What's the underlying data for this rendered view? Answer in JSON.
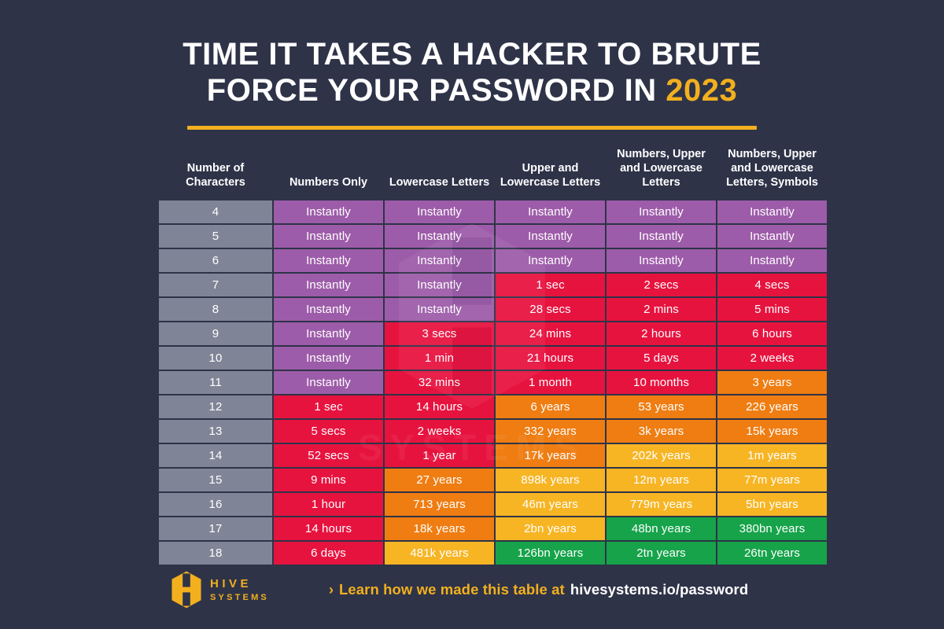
{
  "title": {
    "line1": "TIME IT TAKES A HACKER TO BRUTE",
    "line2_prefix": "FORCE YOUR PASSWORD IN ",
    "year": "2023"
  },
  "colors": {
    "background": "#2e3348",
    "accent_gold": "#f2b01e",
    "instant_purple": "#9d5ca9",
    "red": "#e7133f",
    "orange": "#ef7d12",
    "amber": "#f7b524",
    "green": "#16a34a",
    "gray": "#7f8596",
    "text_white": "#ffffff"
  },
  "watermark": {
    "text": "SYSTEMS"
  },
  "table": {
    "headers": [
      "Number of Characters",
      "Numbers Only",
      "Lowercase Letters",
      "Upper and Lowercase Letters",
      "Numbers, Upper and Lowercase Letters",
      "Numbers, Upper and Lowercase Letters, Symbols"
    ],
    "rows": [
      {
        "chars": "4",
        "cells": [
          {
            "text": "Instantly",
            "color": "purple"
          },
          {
            "text": "Instantly",
            "color": "purple"
          },
          {
            "text": "Instantly",
            "color": "purple"
          },
          {
            "text": "Instantly",
            "color": "purple"
          },
          {
            "text": "Instantly",
            "color": "purple"
          }
        ]
      },
      {
        "chars": "5",
        "cells": [
          {
            "text": "Instantly",
            "color": "purple"
          },
          {
            "text": "Instantly",
            "color": "purple"
          },
          {
            "text": "Instantly",
            "color": "purple"
          },
          {
            "text": "Instantly",
            "color": "purple"
          },
          {
            "text": "Instantly",
            "color": "purple"
          }
        ]
      },
      {
        "chars": "6",
        "cells": [
          {
            "text": "Instantly",
            "color": "purple"
          },
          {
            "text": "Instantly",
            "color": "purple"
          },
          {
            "text": "Instantly",
            "color": "purple"
          },
          {
            "text": "Instantly",
            "color": "purple"
          },
          {
            "text": "Instantly",
            "color": "purple"
          }
        ]
      },
      {
        "chars": "7",
        "cells": [
          {
            "text": "Instantly",
            "color": "purple"
          },
          {
            "text": "Instantly",
            "color": "purple"
          },
          {
            "text": "1 sec",
            "color": "red"
          },
          {
            "text": "2 secs",
            "color": "red"
          },
          {
            "text": "4 secs",
            "color": "red"
          }
        ]
      },
      {
        "chars": "8",
        "cells": [
          {
            "text": "Instantly",
            "color": "purple"
          },
          {
            "text": "Instantly",
            "color": "purple"
          },
          {
            "text": "28 secs",
            "color": "red"
          },
          {
            "text": "2 mins",
            "color": "red"
          },
          {
            "text": "5 mins",
            "color": "red"
          }
        ]
      },
      {
        "chars": "9",
        "cells": [
          {
            "text": "Instantly",
            "color": "purple"
          },
          {
            "text": "3 secs",
            "color": "red"
          },
          {
            "text": "24 mins",
            "color": "red"
          },
          {
            "text": "2 hours",
            "color": "red"
          },
          {
            "text": "6 hours",
            "color": "red"
          }
        ]
      },
      {
        "chars": "10",
        "cells": [
          {
            "text": "Instantly",
            "color": "purple"
          },
          {
            "text": "1 min",
            "color": "red"
          },
          {
            "text": "21 hours",
            "color": "red"
          },
          {
            "text": "5 days",
            "color": "red"
          },
          {
            "text": "2 weeks",
            "color": "red"
          }
        ]
      },
      {
        "chars": "11",
        "cells": [
          {
            "text": "Instantly",
            "color": "purple"
          },
          {
            "text": "32 mins",
            "color": "red"
          },
          {
            "text": "1 month",
            "color": "red"
          },
          {
            "text": "10 months",
            "color": "red"
          },
          {
            "text": "3 years",
            "color": "orange"
          }
        ]
      },
      {
        "chars": "12",
        "cells": [
          {
            "text": "1 sec",
            "color": "red"
          },
          {
            "text": "14 hours",
            "color": "red"
          },
          {
            "text": "6 years",
            "color": "orange"
          },
          {
            "text": "53 years",
            "color": "orange"
          },
          {
            "text": "226 years",
            "color": "orange"
          }
        ]
      },
      {
        "chars": "13",
        "cells": [
          {
            "text": "5 secs",
            "color": "red"
          },
          {
            "text": "2 weeks",
            "color": "red"
          },
          {
            "text": "332 years",
            "color": "orange"
          },
          {
            "text": "3k years",
            "color": "orange"
          },
          {
            "text": "15k years",
            "color": "orange"
          }
        ]
      },
      {
        "chars": "14",
        "cells": [
          {
            "text": "52 secs",
            "color": "red"
          },
          {
            "text": "1 year",
            "color": "red"
          },
          {
            "text": "17k years",
            "color": "orange"
          },
          {
            "text": "202k years",
            "color": "amber"
          },
          {
            "text": "1m years",
            "color": "amber"
          }
        ]
      },
      {
        "chars": "15",
        "cells": [
          {
            "text": "9 mins",
            "color": "red"
          },
          {
            "text": "27 years",
            "color": "orange"
          },
          {
            "text": "898k years",
            "color": "amber"
          },
          {
            "text": "12m years",
            "color": "amber"
          },
          {
            "text": "77m years",
            "color": "amber"
          }
        ]
      },
      {
        "chars": "16",
        "cells": [
          {
            "text": "1 hour",
            "color": "red"
          },
          {
            "text": "713 years",
            "color": "orange"
          },
          {
            "text": "46m years",
            "color": "amber"
          },
          {
            "text": "779m years",
            "color": "amber"
          },
          {
            "text": "5bn years",
            "color": "amber"
          }
        ]
      },
      {
        "chars": "17",
        "cells": [
          {
            "text": "14 hours",
            "color": "red"
          },
          {
            "text": "18k years",
            "color": "orange"
          },
          {
            "text": "2bn years",
            "color": "amber"
          },
          {
            "text": "48bn years",
            "color": "green"
          },
          {
            "text": "380bn years",
            "color": "green"
          }
        ]
      },
      {
        "chars": "18",
        "cells": [
          {
            "text": "6 days",
            "color": "red"
          },
          {
            "text": "481k years",
            "color": "amber"
          },
          {
            "text": "126bn years",
            "color": "green"
          },
          {
            "text": "2tn years",
            "color": "green"
          },
          {
            "text": "26tn years",
            "color": "green"
          }
        ]
      }
    ]
  },
  "footer": {
    "logo_word_1": "HIVE",
    "logo_word_2": "SYSTEMS",
    "chevron": "›",
    "cta_text": "Learn how we made this table at",
    "cta_url": "hivesystems.io/password"
  }
}
